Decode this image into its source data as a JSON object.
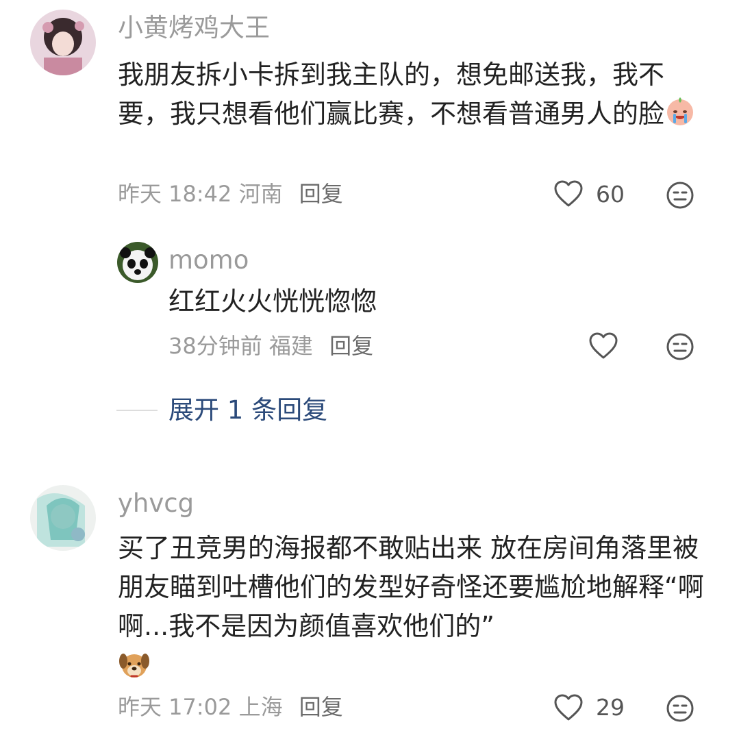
{
  "comments": [
    {
      "user": "小黄烤鸡大王",
      "text": "我朋友拆小卡拆到我主队的，想免邮送我，我不要，我只想看他们赢比赛，不想看普通男人的脸",
      "emoji": "crying-face-emoji",
      "time": "昨天 18:42",
      "location": "河南",
      "reply_label": "回复",
      "likes": "60",
      "replies": [
        {
          "user": "momo",
          "text": "红红火火恍恍惚惚",
          "time": "38分钟前",
          "location": "福建",
          "reply_label": "回复"
        }
      ],
      "expand_label": "展开 1 条回复"
    },
    {
      "user": "yhvcg",
      "text": "买了丑竞男的海报都不敢贴出来 放在房间角落里被朋友瞄到吐槽他们的发型好奇怪还要尴尬地解释“啊啊...我不是因为颜值喜欢他们的”",
      "emoji": "dog-face-emoji",
      "time": "昨天 17:02",
      "location": "上海",
      "reply_label": "回复",
      "likes": "29"
    }
  ],
  "colors": {
    "meta": "#9a9a9a",
    "link": "#2b4a7a",
    "text": "#222222"
  },
  "icons": {
    "like": "heart-icon",
    "dislike": "neutral-face-icon"
  }
}
